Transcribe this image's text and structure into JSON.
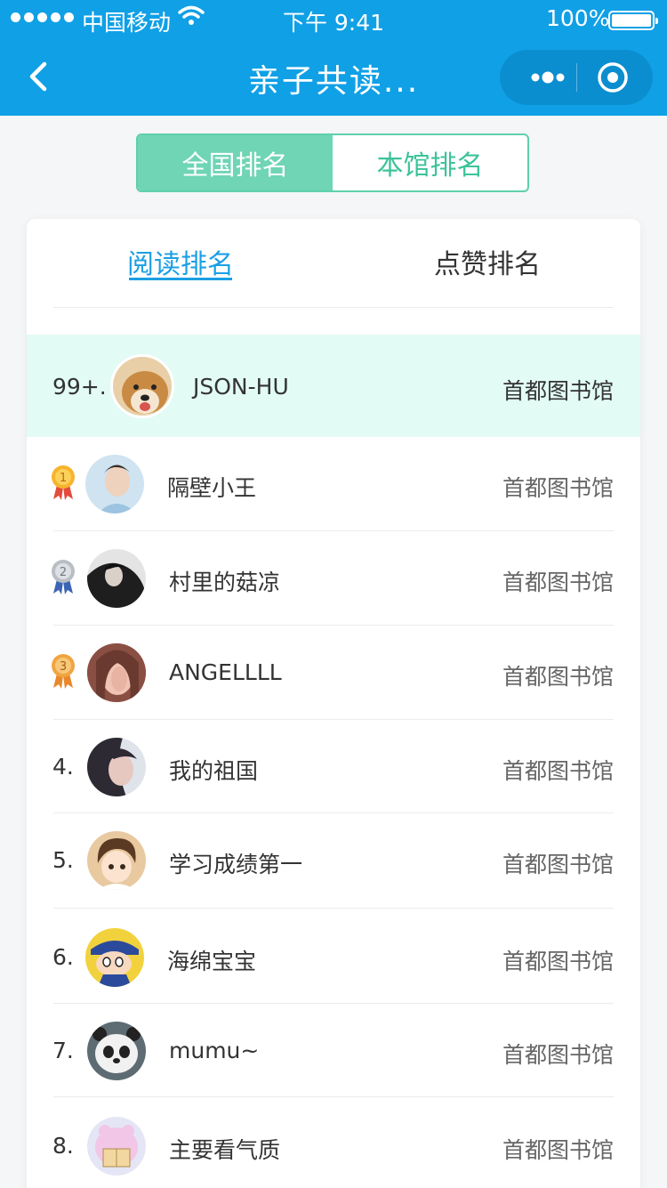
{
  "status_bar": {
    "carrier": "中国移动",
    "time": "下午 9:41",
    "battery": "100%"
  },
  "nav": {
    "title": "亲子共读..."
  },
  "segment": {
    "tabs": [
      {
        "label": "全国排名",
        "active": true
      },
      {
        "label": "本馆排名",
        "active": false
      }
    ]
  },
  "ranking_tabs": [
    {
      "label": "阅读排名",
      "active": true
    },
    {
      "label": "点赞排名",
      "active": false
    }
  ],
  "current_user": {
    "rank": "99+.",
    "name": "JSON-HU",
    "library": "首都图书馆"
  },
  "rankings": [
    {
      "rank": "1",
      "medal": "gold",
      "name": "隔壁小王",
      "library": "首都图书馆"
    },
    {
      "rank": "2",
      "medal": "silver",
      "name": "村里的菇凉",
      "library": "首都图书馆"
    },
    {
      "rank": "3",
      "medal": "bronze",
      "name": "ANGELLLL",
      "library": "首都图书馆"
    },
    {
      "rank": "4.",
      "name": "我的祖国",
      "library": "首都图书馆"
    },
    {
      "rank": "5.",
      "name": "学习成绩第一",
      "library": "首都图书馆"
    },
    {
      "rank": "6.",
      "name": "海绵宝宝",
      "library": "首都图书馆"
    },
    {
      "rank": "7.",
      "name": "mumu~",
      "library": "首都图书馆"
    },
    {
      "rank": "8.",
      "name": "主要看气质",
      "library": "首都图书馆"
    }
  ],
  "colors": {
    "nav_bg": "#10a0e6",
    "accent_blue": "#1b9fe4",
    "accent_green": "#6fd5b4",
    "highlight_row": "#e2fbf5"
  }
}
